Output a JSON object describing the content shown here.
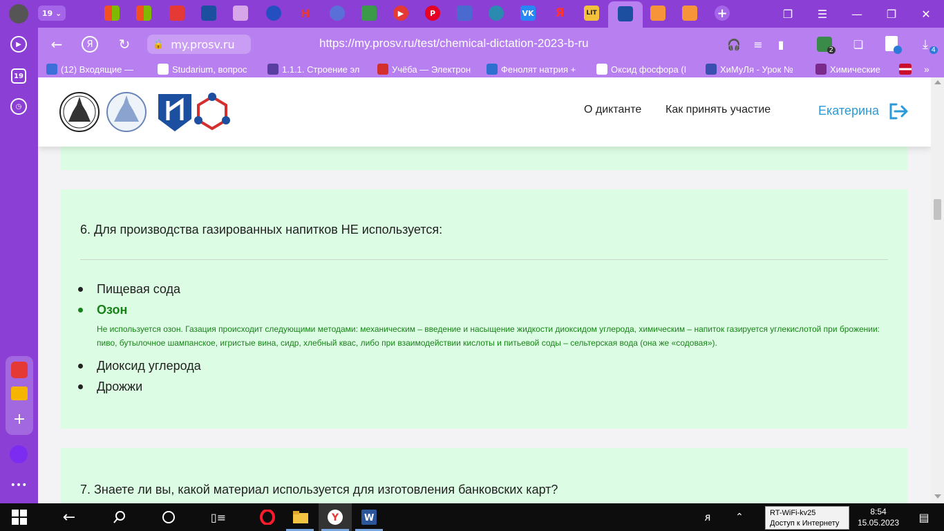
{
  "sidebar": {
    "counter": "19"
  },
  "tabs": {
    "counter": "19",
    "yandex_letter": "Я",
    "lit_label": "LIT"
  },
  "address": {
    "domain": "my.prosv.ru",
    "url": "https://my.prosv.ru/test/chemical-dictation-2023-b-ru",
    "shield_badge": "2",
    "download_badge": "4"
  },
  "bookmarks": [
    {
      "label": "(12) Входящие — ",
      "color": "#3c6fd8"
    },
    {
      "label": "Studarium, вопрос",
      "color": "#ffffff"
    },
    {
      "label": "1.1.1. Строение эл",
      "color": "#5a3da0"
    },
    {
      "label": "Учёба — Электрон",
      "color": "#d32f2f"
    },
    {
      "label": "Фенолят натрия +",
      "color": "#2f6fd0"
    },
    {
      "label": "Оксид фосфора (I",
      "color": "#ffffff"
    },
    {
      "label": "ХиМуЛя - Урок №",
      "color": "#3a4fb0"
    },
    {
      "label": "Химические",
      "color": "#7a2a8a"
    }
  ],
  "header": {
    "nav_about": "О диктанте",
    "nav_how": "Как принять участие",
    "user_name": "Екатерина"
  },
  "question6": {
    "text": "6. Для производства газированных напитков НЕ используется:",
    "answers": [
      "Пищевая сода",
      "Озон",
      "Диоксид углерода",
      "Дрожжи"
    ],
    "correct_index": 1,
    "explanation": "Не используется озон. Газация происходит следующими методами: механическим – введение и насыщение жидкости диоксидом углерода, химическим – напиток газируется углекислотой при брожении: пиво, бутылочное шампанское, игристые вина, сидр, хлебный квас, либо при взаимодействии кислоты и питьевой соды – сельтерская вода (она же «содовая»)."
  },
  "question7": {
    "text": "7. Знаете ли вы, какой материал используется для изготовления банковских карт?"
  },
  "taskbar": {
    "wifi_name": "RT-WiFi-kv25",
    "wifi_status": "Доступ к Интернету",
    "time": "8:54",
    "date": "15.05.2023"
  },
  "colors": {
    "accent": "#b77ff0",
    "card_bg": "#dcfde3",
    "correct": "#178217",
    "link_blue": "#2a9ad8"
  }
}
